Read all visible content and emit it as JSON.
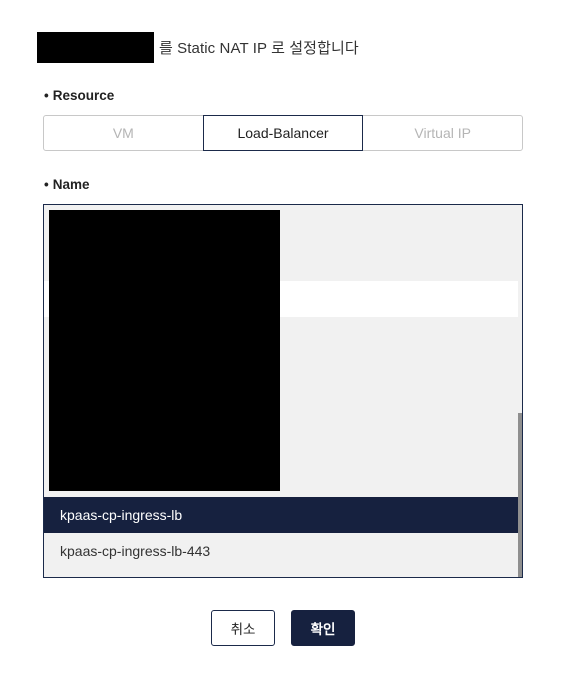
{
  "dialog": {
    "title_suffix": "를 Static NAT IP 로 설정합니다"
  },
  "resource": {
    "label": "Resource",
    "options": [
      {
        "label": "VM",
        "state": "disabled"
      },
      {
        "label": "Load-Balancer",
        "state": "selected"
      },
      {
        "label": "Virtual IP",
        "state": "disabled"
      }
    ]
  },
  "name_field": {
    "label": "Name",
    "visible_items": [
      {
        "label": "kpaas-cp-ingress-lb",
        "selected": true
      },
      {
        "label": "kpaas-cp-ingress-lb-443",
        "selected": false
      }
    ]
  },
  "actions": {
    "cancel_label": "취소",
    "confirm_label": "확인"
  },
  "colors": {
    "accent": "#16213f",
    "border": "#1b2a4a",
    "list_background": "#f1f1f1",
    "disabled_text": "#b5b5b5"
  }
}
